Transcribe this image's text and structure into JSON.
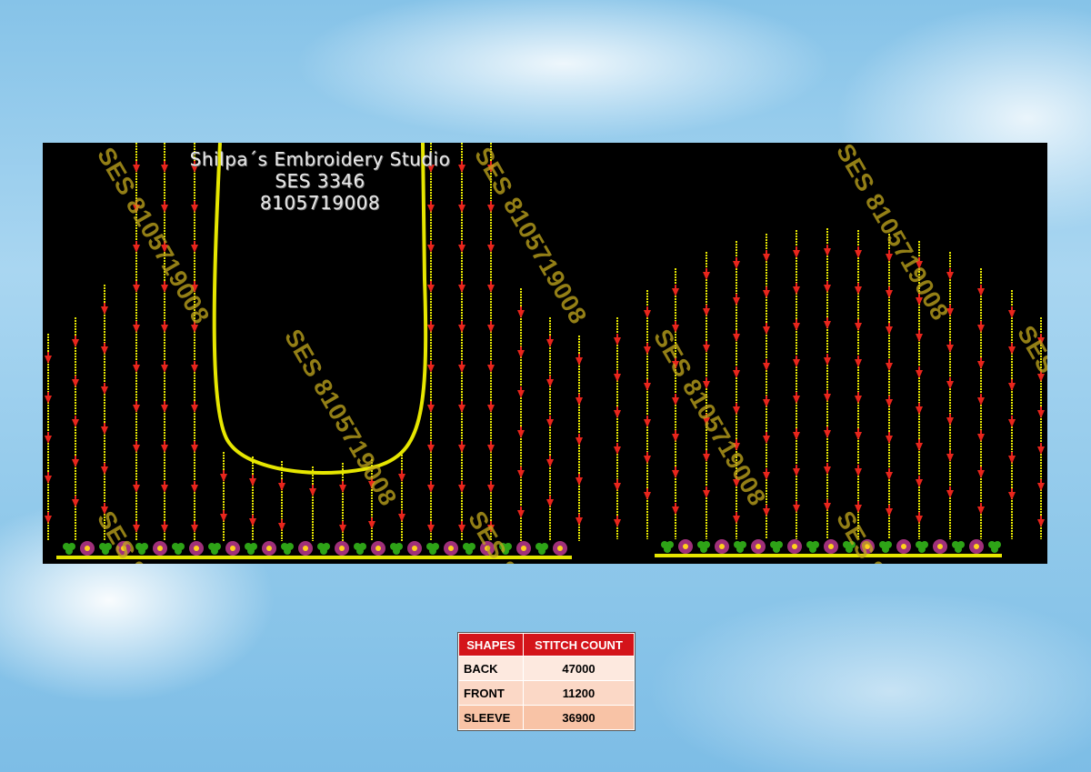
{
  "studio": {
    "name": "Shilpa´s Embroidery Studio",
    "code": "SES 3346",
    "phone": "8105719008"
  },
  "watermark": "SES 8105719008",
  "colors": {
    "background_panel": "#000000",
    "thread_yellow": "#e6e600",
    "drop_red": "#e8251c",
    "leaf_green": "#2ea317",
    "flower_purple": "#a0307a",
    "flower_center": "#ffd21c",
    "table_header": "#d4141a"
  },
  "table": {
    "headers": [
      "SHAPES",
      "STITCH COUNT"
    ],
    "rows": [
      {
        "shape": "BACK",
        "count": "47000"
      },
      {
        "shape": "FRONT",
        "count": "11200"
      },
      {
        "shape": "SLEEVE",
        "count": "36900"
      }
    ]
  }
}
